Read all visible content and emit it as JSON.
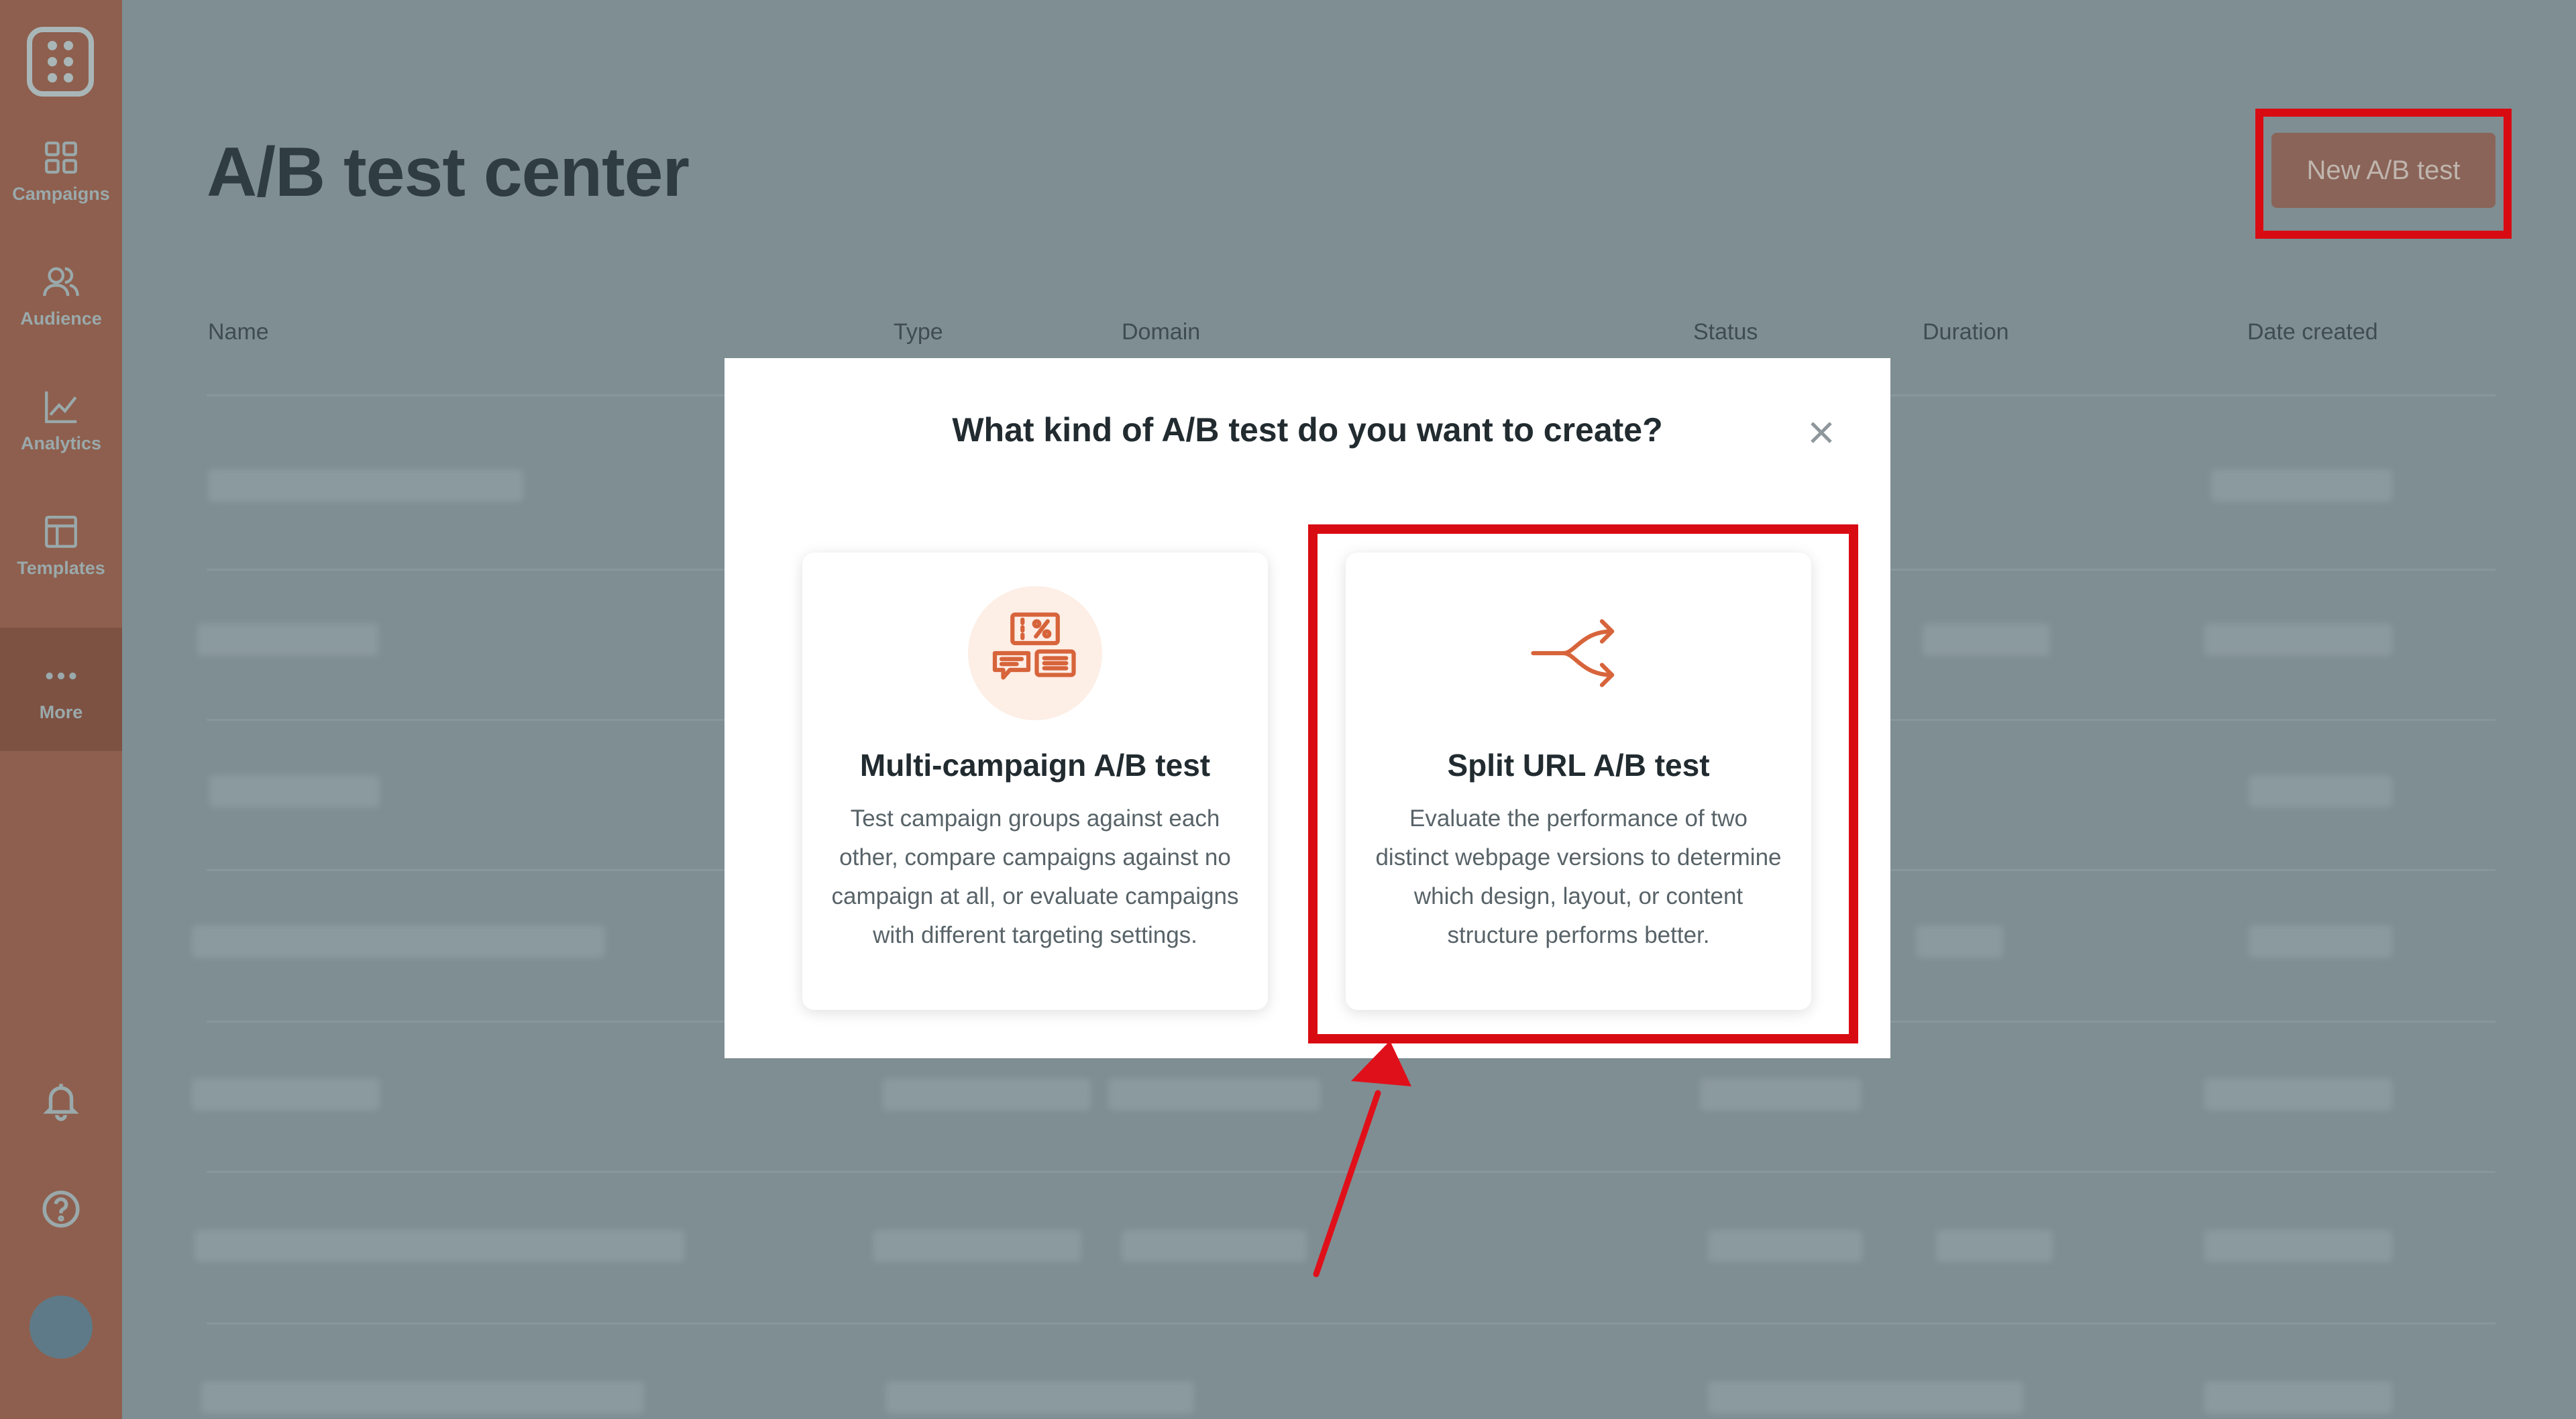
{
  "sidebar": {
    "items": [
      {
        "label": "Campaigns",
        "icon": "grid-icon"
      },
      {
        "label": "Audience",
        "icon": "users-icon"
      },
      {
        "label": "Analytics",
        "icon": "chart-icon"
      },
      {
        "label": "Templates",
        "icon": "layout-icon"
      },
      {
        "label": "More",
        "icon": "more-dots-icon"
      }
    ],
    "active": "More",
    "bottom_icons": [
      "bell-icon",
      "help-icon"
    ]
  },
  "header": {
    "title": "A/B test center",
    "new_button_label": "New A/B test"
  },
  "table": {
    "columns": [
      "Name",
      "Type",
      "Domain",
      "Status",
      "Duration",
      "Date created"
    ]
  },
  "modal": {
    "title": "What kind of A/B test do you want to create?",
    "options": [
      {
        "title": "Multi-campaign A/B test",
        "description": "Test campaign groups against each other, compare campaigns against no campaign at all, or evaluate campaigns with different targeting settings.",
        "icon": "multi-campaign-icon"
      },
      {
        "title": "Split URL A/B test",
        "description": "Evaluate the performance of two distinct webpage versions to determine which design, layout, or content structure performs better.",
        "icon": "split-arrow-icon"
      }
    ]
  },
  "colors": {
    "highlight": "#d90b12",
    "accent": "#d7643b",
    "sidebar": "#8e5f4e",
    "overlay": "#7e8e93"
  }
}
